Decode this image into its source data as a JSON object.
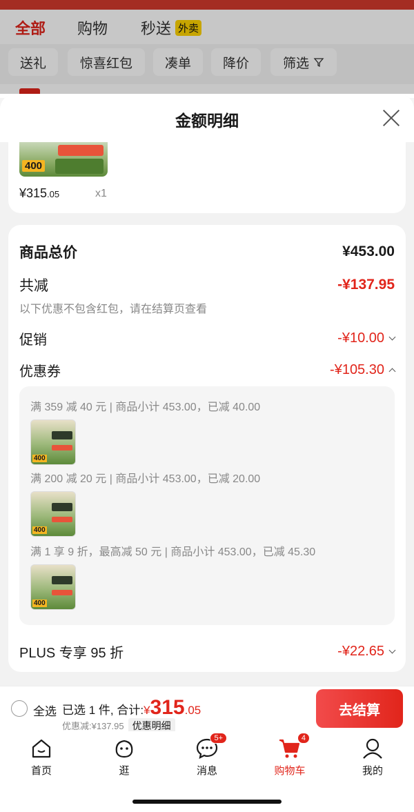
{
  "background": {
    "tabs": [
      {
        "label": "全部",
        "active": true
      },
      {
        "label": "购物",
        "active": false
      },
      {
        "label": "秒送",
        "active": false,
        "badge": "外卖"
      }
    ],
    "chips": [
      "送礼",
      "惊喜红包",
      "凑单",
      "降价",
      "筛选"
    ]
  },
  "sheet": {
    "title": "金额明细",
    "product": {
      "thumb_badge": "400",
      "price_int": "¥315",
      "price_dec": ".05",
      "qty": "x1"
    },
    "total": {
      "label": "商品总价",
      "value": "¥453.00"
    },
    "reduction": {
      "label": "共减",
      "value": "-¥137.95",
      "note": "以下优惠不包含红包，请在结算页查看"
    },
    "promotion": {
      "label": "促销",
      "value": "-¥10.00"
    },
    "coupon": {
      "label": "优惠券",
      "value": "-¥105.30",
      "items": [
        {
          "text": "满 359 减 40 元 | 商品小计 453.00，已减 40.00",
          "thumb_badge": "400"
        },
        {
          "text": "满 200 减 20 元 | 商品小计 453.00，已减 20.00",
          "thumb_badge": "400"
        },
        {
          "text": "满 1 享 9 折，最高减 50 元 | 商品小计 453.00，已减 45.30",
          "thumb_badge": "400"
        }
      ]
    },
    "plus": {
      "label": "PLUS 专享 95 折",
      "value": "-¥22.65"
    }
  },
  "checkout": {
    "select_all": "全选",
    "selected_text": "已选 1 件, 合计:",
    "yen": "¥",
    "amount_int": "315",
    "amount_dec": ".05",
    "discount_text": "优惠减:¥137.95",
    "detail_label": "优惠明细",
    "button_label": "去结算"
  },
  "tabbar": [
    {
      "label": "首页",
      "icon": "home-icon",
      "active": false
    },
    {
      "label": "逛",
      "icon": "browse-icon",
      "active": false
    },
    {
      "label": "消息",
      "icon": "message-icon",
      "active": false,
      "badge": "5+"
    },
    {
      "label": "购物车",
      "icon": "cart-icon",
      "active": true,
      "badge": "4"
    },
    {
      "label": "我的",
      "icon": "profile-icon",
      "active": false
    }
  ],
  "colors": {
    "accent": "#e1251b",
    "muted": "#888888"
  }
}
